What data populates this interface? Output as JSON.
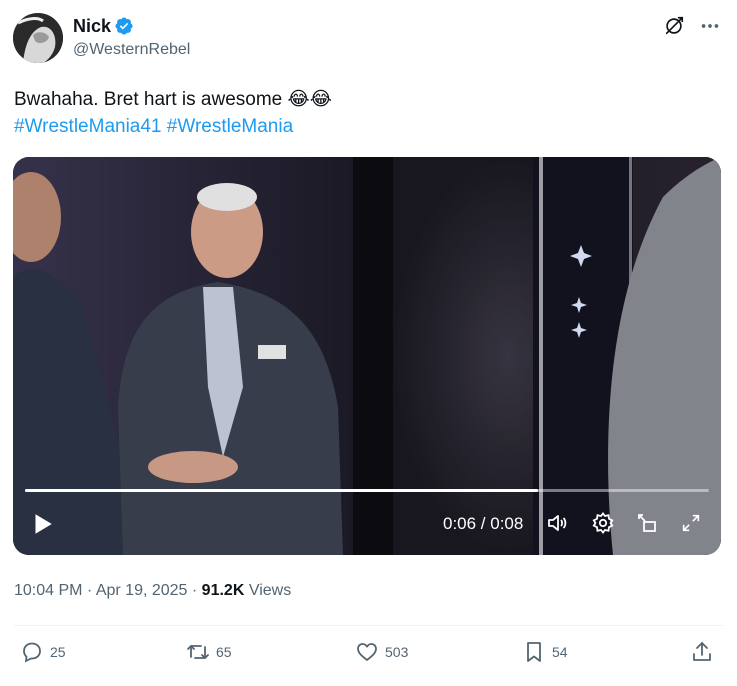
{
  "author": {
    "display_name": "Nick",
    "handle": "@WesternRebel"
  },
  "tweet": {
    "text": "Bwahaha. Bret hart is awesome",
    "emoji": "😂😂",
    "hashtags": [
      "#WrestleMania41",
      "#WrestleMania"
    ]
  },
  "video": {
    "time_display": "0:06 / 0:08",
    "progress_fraction": 0.75
  },
  "meta": {
    "timestamp": "10:04 PM · Apr 19, 2025 · ",
    "views_count": "91.2K",
    "views_label": " Views"
  },
  "actions": {
    "replies": "25",
    "reposts": "65",
    "likes": "503",
    "bookmarks": "54"
  },
  "icons": [
    "verified-badge-icon",
    "grok-icon",
    "more-icon",
    "play-icon",
    "volume-icon",
    "settings-icon",
    "pip-icon",
    "fullscreen-icon",
    "reply-icon",
    "repost-icon",
    "like-icon",
    "bookmark-icon",
    "share-icon"
  ],
  "colors": {
    "accent": "#1d9bf0",
    "text": "#0f1419",
    "secondary": "#536471"
  }
}
